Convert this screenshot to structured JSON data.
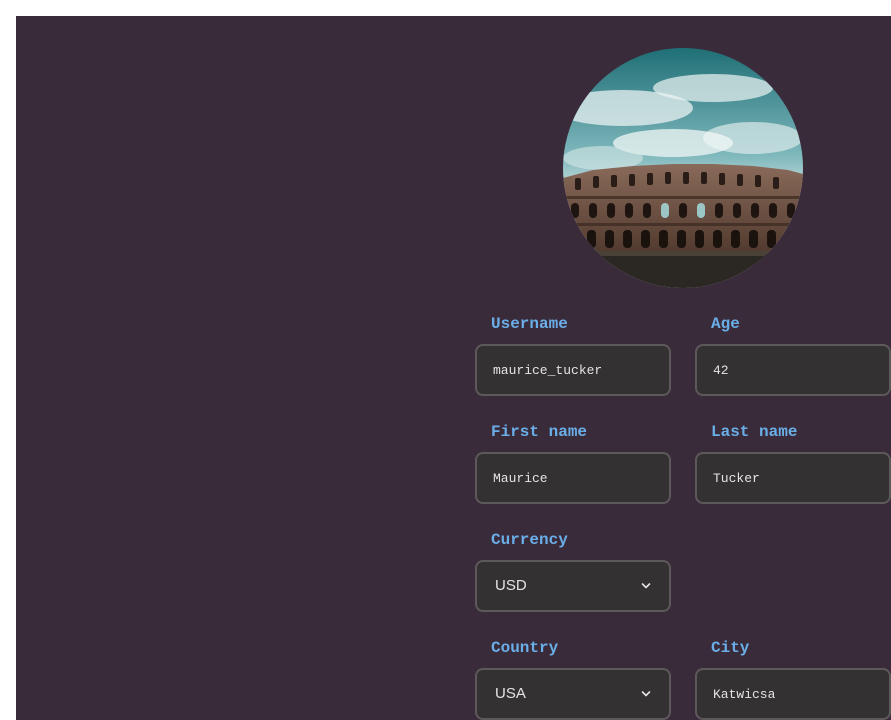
{
  "avatar": {
    "icon": "colosseum-photo"
  },
  "form": {
    "username": {
      "label": "Username",
      "value": "maurice_tucker"
    },
    "age": {
      "label": "Age",
      "value": "42"
    },
    "first_name": {
      "label": "First name",
      "value": "Maurice"
    },
    "last_name": {
      "label": "Last name",
      "value": "Tucker"
    },
    "currency": {
      "label": "Currency",
      "value": "USD"
    },
    "country": {
      "label": "Country",
      "value": "USA"
    },
    "city": {
      "label": "City",
      "value": "Katwicsa"
    }
  },
  "colors": {
    "background": "#3a2b3b",
    "label": "#6aaee8",
    "field_bg": "#333131",
    "field_border": "#5d595a",
    "field_text": "#e6e3e3"
  }
}
